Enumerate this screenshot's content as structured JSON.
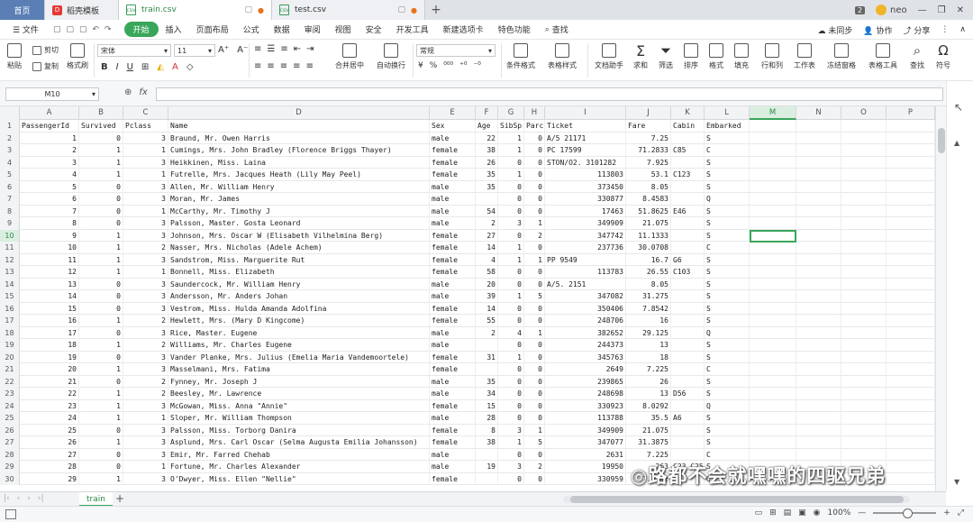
{
  "tabs": {
    "home": "首页",
    "docer": "稻壳模板",
    "doc1": "train.csv",
    "doc2": "test.csv",
    "add": "+"
  },
  "window": {
    "badge": "2",
    "user": "neo",
    "min": "—",
    "restore": "❐",
    "close": "✕"
  },
  "menu": {
    "file": "☰ 文件",
    "items": [
      "开始",
      "插入",
      "页面布局",
      "公式",
      "数据",
      "审阅",
      "视图",
      "安全",
      "开发工具",
      "新建选项卡",
      "特色功能",
      "查找"
    ],
    "right": [
      "未同步",
      "协作",
      "分享"
    ]
  },
  "ribbon": {
    "paste": "粘贴",
    "cut": "剪切",
    "copy": "复制",
    "format_painter": "格式刷",
    "font_name": "宋体",
    "font_size": "11",
    "bold": "B",
    "italic": "I",
    "underline": "U",
    "font_color": "A",
    "merge": "合并居中",
    "wrap": "自动换行",
    "num_format": "常规",
    "cond_format": "条件格式",
    "table_style": "表格样式",
    "doc_assist": "文档助手",
    "sum": "求和",
    "filter": "筛选",
    "sort": "排序",
    "format": "格式",
    "fill": "填充",
    "rowcol": "行和列",
    "worksheet": "工作表",
    "freeze": "冻结窗格",
    "table_tools": "表格工具",
    "find": "查找",
    "symbol": "符号"
  },
  "formula_bar": {
    "name_box": "M10",
    "fx": "fx"
  },
  "grid": {
    "columns": [
      "A",
      "B",
      "C",
      "D",
      "E",
      "F",
      "G",
      "H",
      "I",
      "J",
      "K",
      "L",
      "M",
      "N",
      "O",
      "P"
    ],
    "selected_column": "M",
    "selected_row": "10",
    "header": [
      "PassengerId",
      "Survived",
      "Pclass",
      "Name",
      "Sex",
      "Age",
      "SibSp",
      "Parch",
      "Ticket",
      "Fare",
      "Cabin",
      "Embarked"
    ],
    "rows": [
      [
        "1",
        "0",
        "3",
        "Braund, Mr. Owen Harris",
        "male",
        "22",
        "1",
        "0",
        "A/5 21171",
        "7.25",
        "",
        "S"
      ],
      [
        "2",
        "1",
        "1",
        "Cumings, Mrs. John Bradley (Florence Briggs Thayer)",
        "female",
        "38",
        "1",
        "0",
        "PC 17599",
        "71.2833",
        "C85",
        "C"
      ],
      [
        "3",
        "1",
        "3",
        "Heikkinen, Miss. Laina",
        "female",
        "26",
        "0",
        "0",
        "STON/O2. 3101282",
        "7.925",
        "",
        "S"
      ],
      [
        "4",
        "1",
        "1",
        "Futrelle, Mrs. Jacques Heath (Lily May Peel)",
        "female",
        "35",
        "1",
        "0",
        "113803",
        "53.1",
        "C123",
        "S"
      ],
      [
        "5",
        "0",
        "3",
        "Allen, Mr. William Henry",
        "male",
        "35",
        "0",
        "0",
        "373450",
        "8.05",
        "",
        "S"
      ],
      [
        "6",
        "0",
        "3",
        "Moran, Mr. James",
        "male",
        "",
        "0",
        "0",
        "330877",
        "8.4583",
        "",
        "Q"
      ],
      [
        "7",
        "0",
        "1",
        "McCarthy, Mr. Timothy J",
        "male",
        "54",
        "0",
        "0",
        "17463",
        "51.8625",
        "E46",
        "S"
      ],
      [
        "8",
        "0",
        "3",
        "Palsson, Master. Gosta Leonard",
        "male",
        "2",
        "3",
        "1",
        "349909",
        "21.075",
        "",
        "S"
      ],
      [
        "9",
        "1",
        "3",
        "Johnson, Mrs. Oscar W (Elisabeth Vilhelmina Berg)",
        "female",
        "27",
        "0",
        "2",
        "347742",
        "11.1333",
        "",
        "S"
      ],
      [
        "10",
        "1",
        "2",
        "Nasser, Mrs. Nicholas (Adele Achem)",
        "female",
        "14",
        "1",
        "0",
        "237736",
        "30.0708",
        "",
        "C"
      ],
      [
        "11",
        "1",
        "3",
        "Sandstrom, Miss. Marguerite Rut",
        "female",
        "4",
        "1",
        "1",
        "PP 9549",
        "16.7",
        "G6",
        "S"
      ],
      [
        "12",
        "1",
        "1",
        "Bonnell, Miss. Elizabeth",
        "female",
        "58",
        "0",
        "0",
        "113783",
        "26.55",
        "C103",
        "S"
      ],
      [
        "13",
        "0",
        "3",
        "Saundercock, Mr. William Henry",
        "male",
        "20",
        "0",
        "0",
        "A/5. 2151",
        "8.05",
        "",
        "S"
      ],
      [
        "14",
        "0",
        "3",
        "Andersson, Mr. Anders Johan",
        "male",
        "39",
        "1",
        "5",
        "347082",
        "31.275",
        "",
        "S"
      ],
      [
        "15",
        "0",
        "3",
        "Vestrom, Miss. Hulda Amanda Adolfina",
        "female",
        "14",
        "0",
        "0",
        "350406",
        "7.8542",
        "",
        "S"
      ],
      [
        "16",
        "1",
        "2",
        "Hewlett, Mrs. (Mary D Kingcome)",
        "female",
        "55",
        "0",
        "0",
        "248706",
        "16",
        "",
        "S"
      ],
      [
        "17",
        "0",
        "3",
        "Rice, Master. Eugene",
        "male",
        "2",
        "4",
        "1",
        "382652",
        "29.125",
        "",
        "Q"
      ],
      [
        "18",
        "1",
        "2",
        "Williams, Mr. Charles Eugene",
        "male",
        "",
        "0",
        "0",
        "244373",
        "13",
        "",
        "S"
      ],
      [
        "19",
        "0",
        "3",
        "Vander Planke, Mrs. Julius (Emelia Maria Vandemoortele)",
        "female",
        "31",
        "1",
        "0",
        "345763",
        "18",
        "",
        "S"
      ],
      [
        "20",
        "1",
        "3",
        "Masselmani, Mrs. Fatima",
        "female",
        "",
        "0",
        "0",
        "2649",
        "7.225",
        "",
        "C"
      ],
      [
        "21",
        "0",
        "2",
        "Fynney, Mr. Joseph J",
        "male",
        "35",
        "0",
        "0",
        "239865",
        "26",
        "",
        "S"
      ],
      [
        "22",
        "1",
        "2",
        "Beesley, Mr. Lawrence",
        "male",
        "34",
        "0",
        "0",
        "248698",
        "13",
        "D56",
        "S"
      ],
      [
        "23",
        "1",
        "3",
        "McGowan, Miss. Anna \"Annie\"",
        "female",
        "15",
        "0",
        "0",
        "330923",
        "8.0292",
        "",
        "Q"
      ],
      [
        "24",
        "1",
        "1",
        "Sloper, Mr. William Thompson",
        "male",
        "28",
        "0",
        "0",
        "113788",
        "35.5",
        "A6",
        "S"
      ],
      [
        "25",
        "0",
        "3",
        "Palsson, Miss. Torborg Danira",
        "female",
        "8",
        "3",
        "1",
        "349909",
        "21.075",
        "",
        "S"
      ],
      [
        "26",
        "1",
        "3",
        "Asplund, Mrs. Carl Oscar (Selma Augusta Emilia Johansson)",
        "female",
        "38",
        "1",
        "5",
        "347077",
        "31.3875",
        "",
        "S"
      ],
      [
        "27",
        "0",
        "3",
        "Emir, Mr. Farred Chehab",
        "male",
        "",
        "0",
        "0",
        "2631",
        "7.225",
        "",
        "C"
      ],
      [
        "28",
        "0",
        "1",
        "Fortune, Mr. Charles Alexander",
        "male",
        "19",
        "3",
        "2",
        "19950",
        "263",
        "C23 C25",
        "S"
      ],
      [
        "29",
        "1",
        "3",
        "O'Dwyer, Miss. Ellen \"Nellie\"",
        "female",
        "",
        "0",
        "0",
        "330959",
        "7.8792",
        "",
        "Q"
      ]
    ]
  },
  "sheet": {
    "name": "train",
    "add": "+"
  },
  "status": {
    "zoom": "100%",
    "minus": "—",
    "plus": "+"
  },
  "watermark": "◎路都不会就嘿嘿的四驱兄弟"
}
